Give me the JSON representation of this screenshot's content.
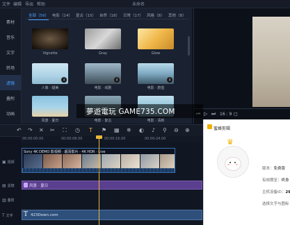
{
  "menubar": {
    "items": [
      "文件",
      "编辑",
      "导出",
      "帮助"
    ],
    "title": "未命名"
  },
  "sidebar": {
    "items": [
      {
        "label": "素材",
        "active": false
      },
      {
        "label": "音乐",
        "active": false
      },
      {
        "label": "文字",
        "active": false
      },
      {
        "label": "转场",
        "active": false
      },
      {
        "label": "滤镜",
        "active": true
      },
      {
        "label": "叠附",
        "active": false
      },
      {
        "label": "动画",
        "active": false
      }
    ]
  },
  "library": {
    "tabs": [
      {
        "label": "全部（59）",
        "active": true
      },
      {
        "label": "电影（14）",
        "active": false
      },
      {
        "label": "复古（15）",
        "active": false
      },
      {
        "label": "自然（18）",
        "active": false
      },
      {
        "label": "日常（17）",
        "active": false
      },
      {
        "label": "风格（8）",
        "active": false
      },
      {
        "label": "其他（8）",
        "active": false
      }
    ],
    "items": [
      {
        "label": "Vignette",
        "download": false
      },
      {
        "label": "Gray",
        "download": false
      },
      {
        "label": "Glow",
        "download": false
      },
      {
        "label": "人像 · 甜美",
        "download": true
      },
      {
        "label": "电影 · 戏剧",
        "download": true
      },
      {
        "label": "电影 · 蔚蓝",
        "download": true
      },
      {
        "label": "风景 · 夏日",
        "download": false
      },
      {
        "label": "电影 · 复古",
        "download": false
      },
      {
        "label": "电影 · 清新",
        "download": false
      }
    ]
  },
  "preview": {
    "ratio": "16 : 9"
  },
  "timeline": {
    "ruler": [
      "00:00:00.00",
      "00:00:08.00",
      "00:00:16.00",
      "00:00:24.00"
    ],
    "tracks": [
      {
        "label": "视频"
      },
      {
        "label": "滤镜"
      },
      {
        "label": "叠附"
      },
      {
        "label": "文字"
      }
    ],
    "video_clip_title": "Sony 4K DEMO  影视频 · 超清影片 · 4K HDR · Live",
    "filter_clip_label": "风景 · 夏日",
    "text_clip_label": "423Down.com"
  },
  "watermark": {
    "text": "夢遊電玩 GAME735.COM"
  },
  "popup": {
    "title": "蜜蜂剪辑",
    "rows": [
      {
        "key": "版本：",
        "value": "免费版"
      },
      {
        "key": "有效期至：",
        "value": "终身"
      },
      {
        "key": "主机设备ID：",
        "value": "29"
      },
      {
        "key": "选择文字与图标"
      }
    ]
  }
}
